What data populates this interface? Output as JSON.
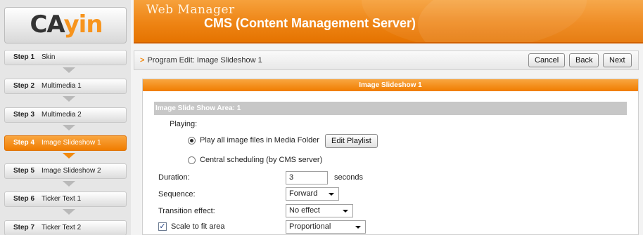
{
  "logo": {
    "part1": "CA",
    "part2": "yin"
  },
  "header": {
    "title": "Web Manager",
    "subtitle": "CMS (Content Management Server)"
  },
  "steps": [
    {
      "num": "Step 1",
      "label": "Skin",
      "active": false
    },
    {
      "num": "Step 2",
      "label": "Multimedia 1",
      "active": false
    },
    {
      "num": "Step 3",
      "label": "Multimedia 2",
      "active": false
    },
    {
      "num": "Step 4",
      "label": "Image Slideshow 1",
      "active": true
    },
    {
      "num": "Step 5",
      "label": "Image Slideshow 2",
      "active": false
    },
    {
      "num": "Step 6",
      "label": "Ticker Text 1",
      "active": false
    },
    {
      "num": "Step 7",
      "label": "Ticker Text 2",
      "active": false
    }
  ],
  "toolbar": {
    "breadcrumb_marker": ">",
    "breadcrumb": "Program Edit: Image Slideshow 1",
    "cancel_label": "Cancel",
    "back_label": "Back",
    "next_label": "Next"
  },
  "panel": {
    "title": "Image Slideshow 1",
    "area_title": "Image Slide Show Area: 1",
    "playing_label": "Playing:",
    "option_media_folder": "Play all image files in Media Folder",
    "option_media_folder_checked": true,
    "edit_playlist_label": "Edit Playlist",
    "option_central": "Central scheduling (by CMS server)",
    "option_central_checked": false,
    "duration_label": "Duration:",
    "duration_value": "3",
    "duration_unit": "seconds",
    "sequence_label": "Sequence:",
    "sequence_value": "Forward",
    "transition_label": "Transition effect:",
    "transition_value": "No effect",
    "scale_label": "Scale to fit area",
    "scale_checked": true,
    "scale_value": "Proportional"
  },
  "colors": {
    "accent": "#f28a10",
    "active_step": "#f07c00",
    "area_bar": "#c7c7c7"
  }
}
